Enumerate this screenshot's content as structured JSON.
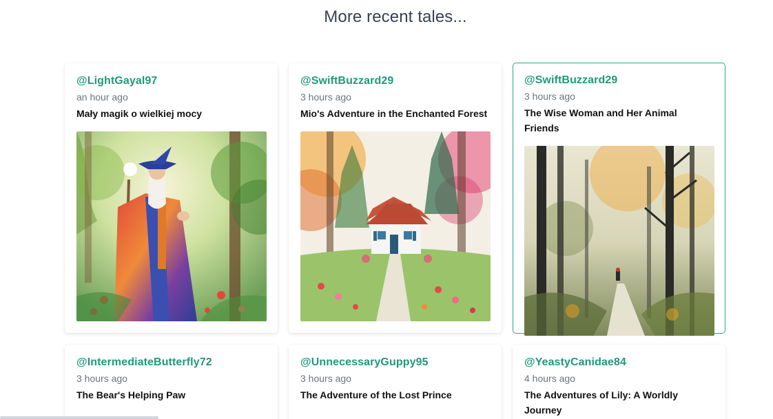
{
  "section": {
    "heading": "More recent tales..."
  },
  "cards": [
    {
      "user": "@LightGayal97",
      "time": "an hour ago",
      "title": "Mały magik o wielkiej mocy",
      "image": "wizard-painting"
    },
    {
      "user": "@SwiftBuzzard29",
      "time": "3 hours ago",
      "title": "Mio's Adventure in the Enchanted Forest",
      "image": "cottage-painting"
    },
    {
      "user": "@SwiftBuzzard29",
      "time": "3 hours ago",
      "title": "The Wise Woman and Her Animal Friends",
      "image": "forest-path-painting"
    },
    {
      "user": "@IntermediateButterfly72",
      "time": "3 hours ago",
      "title": "The Bear's Helping Paw"
    },
    {
      "user": "@UnnecessaryGuppy95",
      "time": "3 hours ago",
      "title": "The Adventure of the Lost Prince"
    },
    {
      "user": "@YeastyCanidae84",
      "time": "4 hours ago",
      "title": "The Adventures of Lily: A Worldly Journey"
    }
  ],
  "colors": {
    "accent": "#1f9a79",
    "selected_border": "#2aa884",
    "heading": "#374151",
    "muted": "#6b7280"
  }
}
